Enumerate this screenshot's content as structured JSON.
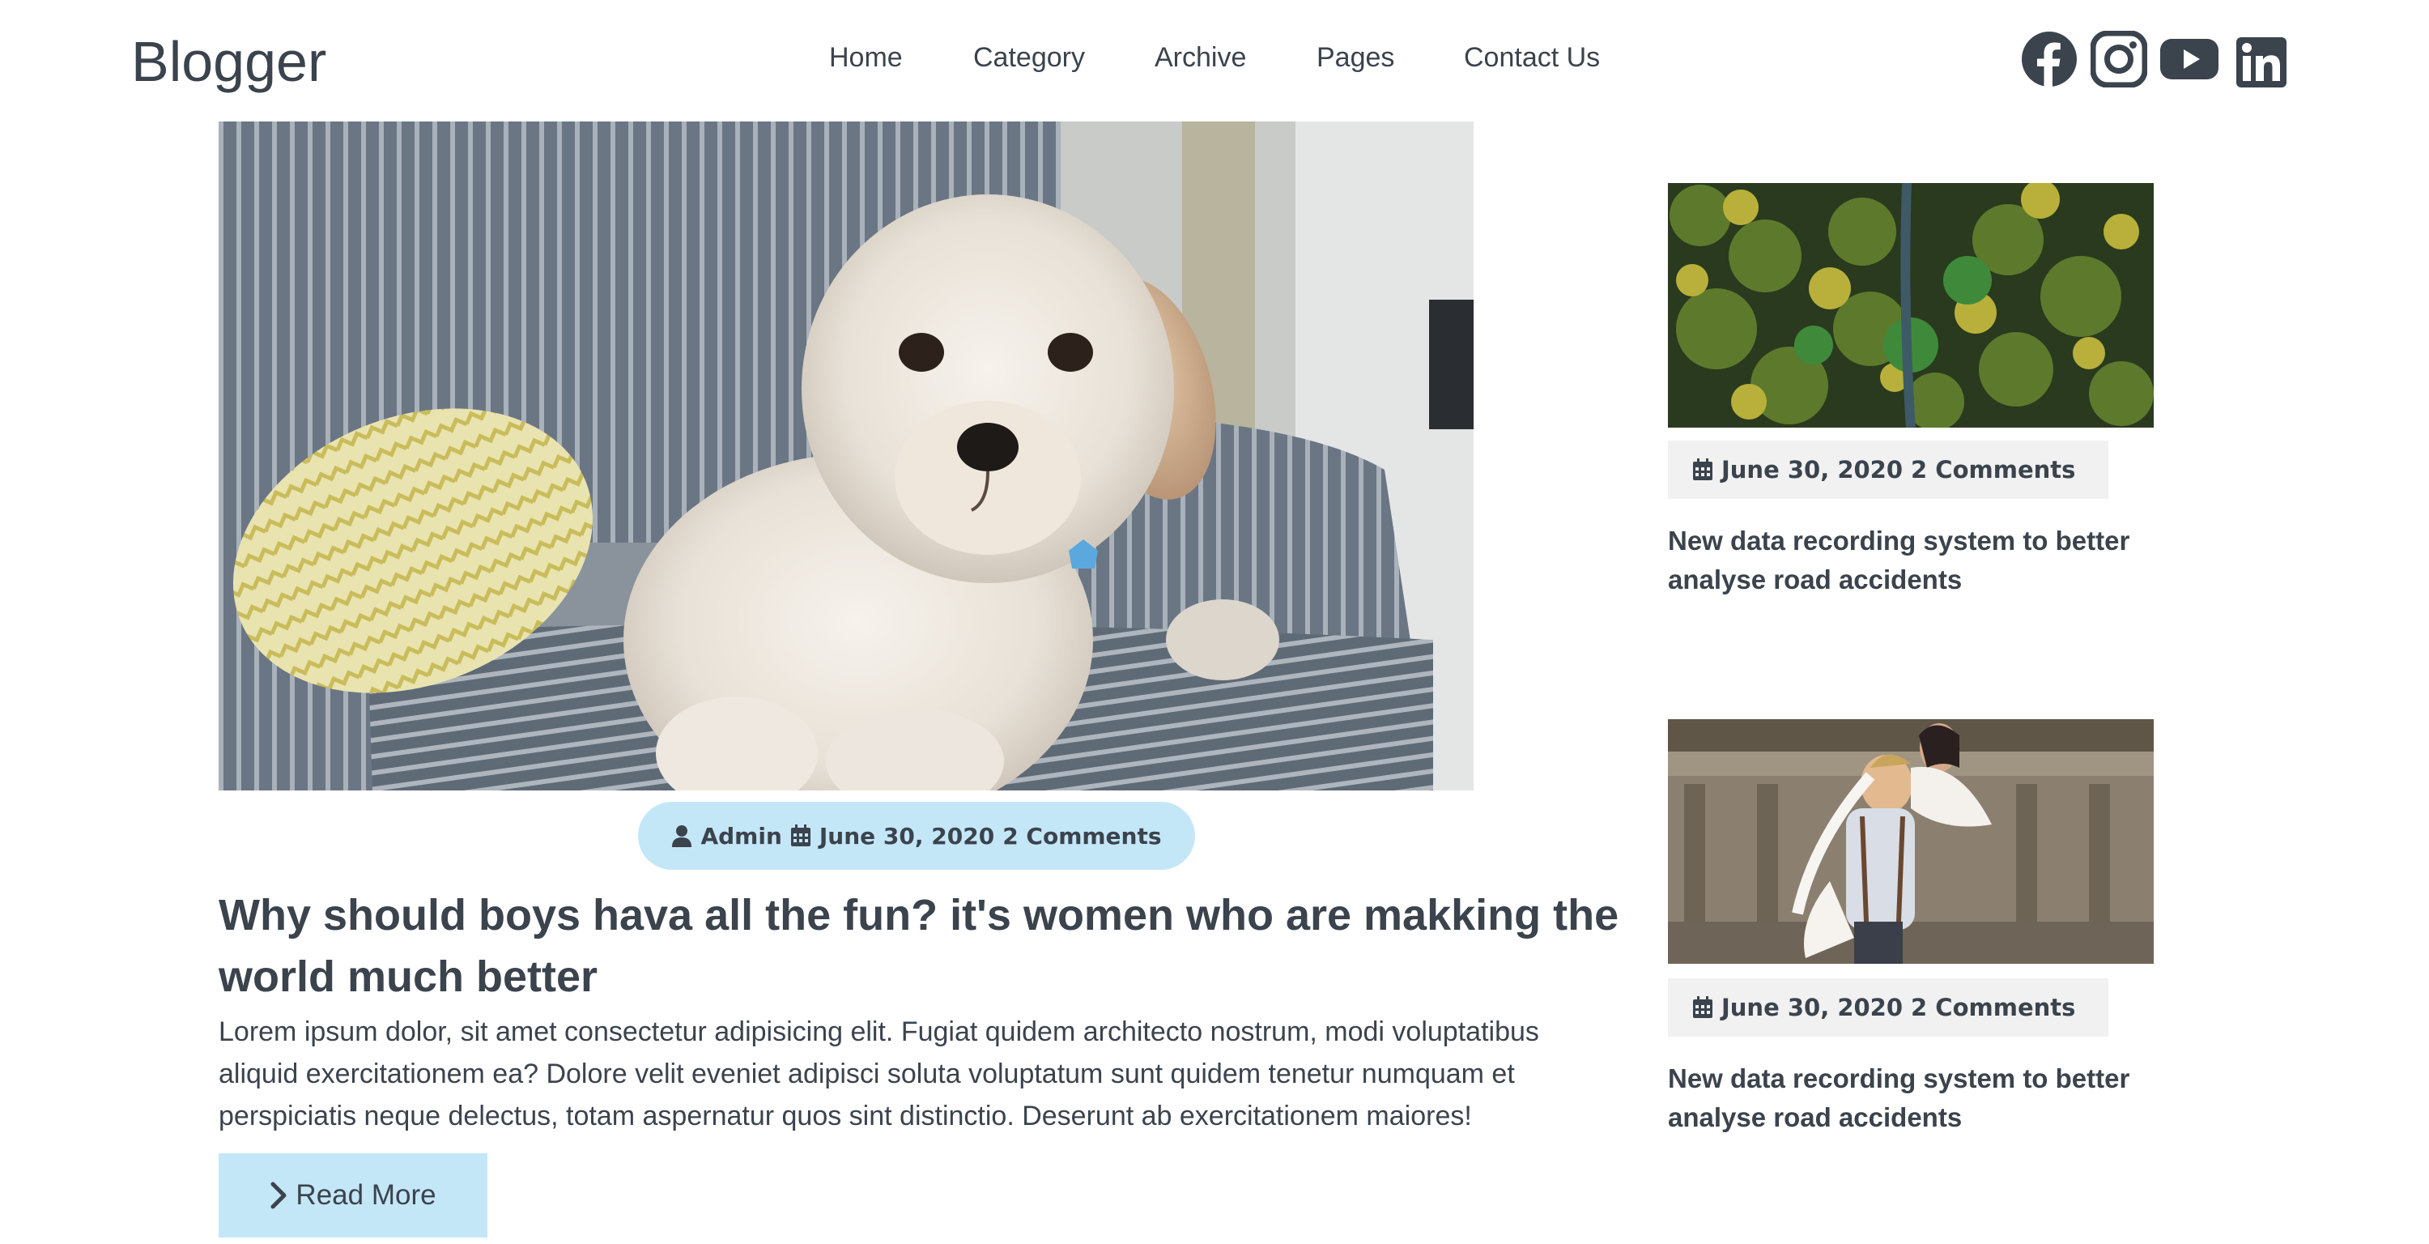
{
  "header": {
    "logo": "Blogger",
    "nav": [
      "Home",
      "Category",
      "Archive",
      "Pages",
      "Contact Us"
    ],
    "socials": [
      "facebook-icon",
      "instagram-icon",
      "youtube-icon",
      "linkedin-icon"
    ]
  },
  "featured": {
    "image": "dog-on-armchair",
    "meta": {
      "author": "Admin",
      "date": "June 30, 2020",
      "comments": "2 Comments"
    },
    "title": "Why should boys hava all the fun? it's women who are makking the world much better",
    "excerpt": "Lorem ipsum dolor, sit amet consectetur adipisicing elit. Fugiat quidem architecto nostrum, modi voluptatibus aliquid exercitationem ea? Dolore velit eveniet adipisci soluta voluptatum sunt quidem tenetur numquam et perspiciatis neque delectus, totam aspernatur quos sint distinctio. Deserunt ab exercitationem maiores!",
    "read_more": "Read More"
  },
  "sidebar": {
    "posts": [
      {
        "image": "aerial-forest-road",
        "date": "June 30, 2020",
        "comments": "2 Comments",
        "title": "New data recording system to better analyse road accidents"
      },
      {
        "image": "wedding-couple",
        "date": "June 30, 2020",
        "comments": "2 Comments",
        "title": "New data recording system to better analyse road accidents"
      }
    ]
  },
  "colors": {
    "text": "#3b434d",
    "accent": "#c4e7f8",
    "meta_box_bg": "#f1f1f1"
  }
}
